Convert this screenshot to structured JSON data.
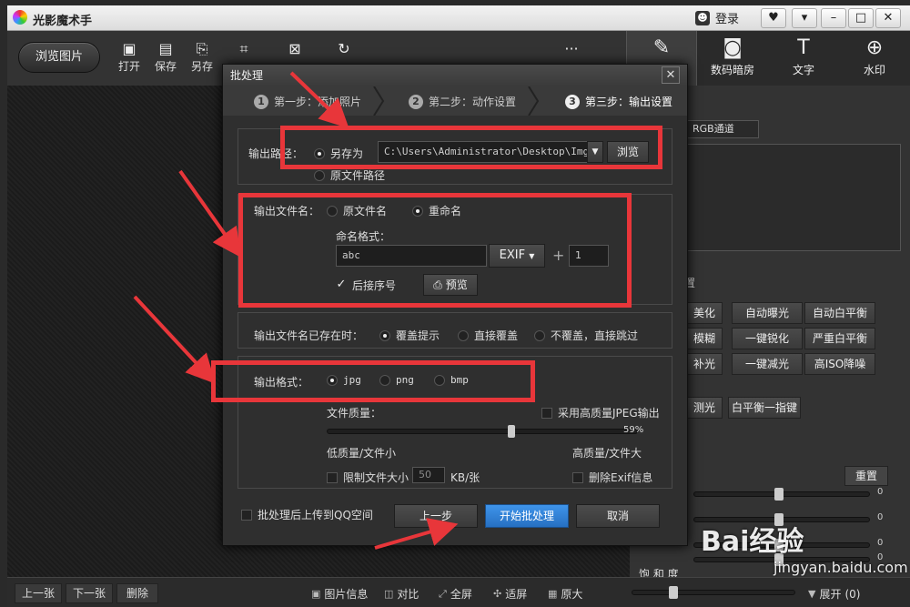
{
  "app": {
    "title": "光影魔术手",
    "login": "登录"
  },
  "toolbar": {
    "browse": "浏览图片",
    "items": [
      {
        "label": "打开",
        "icon": "open-image-icon"
      },
      {
        "label": "保存",
        "icon": "save-icon"
      },
      {
        "label": "另存",
        "icon": "save-as-icon"
      }
    ],
    "more": "···"
  },
  "right_tabs": [
    {
      "label": "",
      "icon": "edit-icon"
    },
    {
      "label": "数码暗房",
      "icon": "camera-icon"
    },
    {
      "label": "文字",
      "icon": "text-icon"
    },
    {
      "label": "水印",
      "icon": "watermark-icon"
    }
  ],
  "right_panel": {
    "channel": "RGB通道",
    "section_char": "置",
    "buttons": [
      "美化",
      "自动曝光",
      "自动白平衡",
      "模糊",
      "一键锐化",
      "严重白平衡",
      "补光",
      "一键减光",
      "高ISO降噪",
      "测光",
      "白平衡一指键"
    ],
    "reset": "重置",
    "sliders": [
      {
        "label": "",
        "value": "0"
      },
      {
        "label": "",
        "value": "0"
      },
      {
        "label": "",
        "value": "0"
      },
      {
        "label": "",
        "value": "0"
      },
      {
        "label": "饱 和 度",
        "value": "0"
      }
    ]
  },
  "bottom": {
    "prev": "上一张",
    "next": "下一张",
    "delete": "删除",
    "info": "图片信息",
    "compare": "对比",
    "fullscreen": "全屏",
    "fit": "适屏",
    "original": "原大",
    "expand": "展开",
    "expand_count": "(0)"
  },
  "dialog": {
    "title": "批处理",
    "close": "✕",
    "steps": [
      {
        "num": "1",
        "label": "第一步：添加照片"
      },
      {
        "num": "2",
        "label": "第二步：动作设置"
      },
      {
        "num": "3",
        "label": "第三步：输出设置"
      }
    ],
    "output_path": {
      "label": "输出路径：",
      "save_as": "另存为",
      "path": "C:\\Users\\Administrator\\Desktop\\Img",
      "browse": "浏览",
      "original_path": "原文件路径"
    },
    "output_name": {
      "label": "输出文件名：",
      "original": "原文件名",
      "rename": "重命名",
      "format_label": "命名格式：",
      "prefix": "abc",
      "exif": "EXIF",
      "plus": "+",
      "number": "1",
      "suffix_check": "后接序号",
      "preview": "预览"
    },
    "exists": {
      "label": "输出文件名已存在时：",
      "options": [
        "覆盖提示",
        "直接覆盖",
        "不覆盖，直接跳过"
      ]
    },
    "format": {
      "label": "输出格式：",
      "options": [
        "jpg",
        "png",
        "bmp"
      ]
    },
    "quality": {
      "label": "文件质量：",
      "hq_jpeg": "采用高质量JPEG输出",
      "value": "59%",
      "fraction": 0.59,
      "low": "低质量/文件小",
      "high": "高质量/文件大",
      "limit": "限制文件大小",
      "limit_value": "50",
      "limit_unit": "KB/张",
      "strip_exif": "删除Exif信息"
    },
    "upload": "批处理后上传到QQ空间",
    "prev_step": "上一步",
    "start": "开始批处理",
    "cancel": "取消"
  },
  "watermark": {
    "brand": "Bai经验",
    "site": "jingyan.baidu.com"
  },
  "colors": {
    "accent_blue": "#2f7fd6",
    "annotation_red": "#e8363a"
  }
}
